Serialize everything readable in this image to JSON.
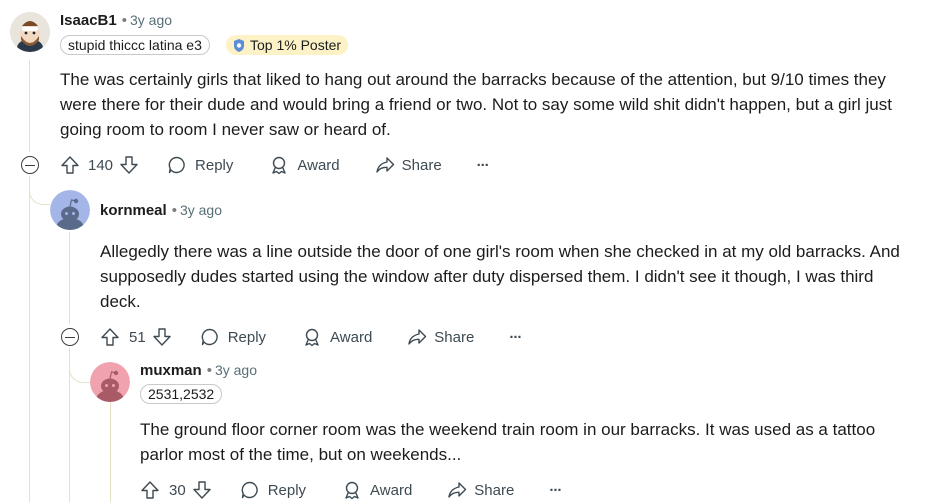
{
  "comments": [
    {
      "username": "IsaacB1",
      "age": "3y ago",
      "flairs": [
        "stupid thiccc latina e3",
        "Top 1% Poster"
      ],
      "body": "The was certainly girls that liked to hang out around the barracks because of the attention, but 9/10 times they were there for their dude and would bring a friend or two. Not to say some wild shit didn't happen, but a girl just going room to room I never saw or heard of.",
      "votes": "140"
    },
    {
      "username": "kornmeal",
      "age": "3y ago",
      "body": "Allegedly there was a line outside the door of one girl's room when she checked in at my old barracks. And supposedly dudes started using the window after duty dispersed them. I didn't see it though, I was third deck.",
      "votes": "51"
    },
    {
      "username": "muxman",
      "age": "3y ago",
      "flairs": [
        "2531,2532"
      ],
      "body": "The ground floor corner room was the weekend train room in our barracks. It was used as a tattoo parlor most of the time, but on weekends...",
      "votes": "30"
    }
  ],
  "actions": {
    "reply": "Reply",
    "award": "Award",
    "share": "Share",
    "more": "···"
  },
  "separator": "•",
  "colors": {
    "thread": "#e5e2c8",
    "meta": "#576f76",
    "gold_flair": "#fdf2c6",
    "avatar_blue": "#a4b5e8",
    "avatar_pink": "#f0a3ae"
  }
}
